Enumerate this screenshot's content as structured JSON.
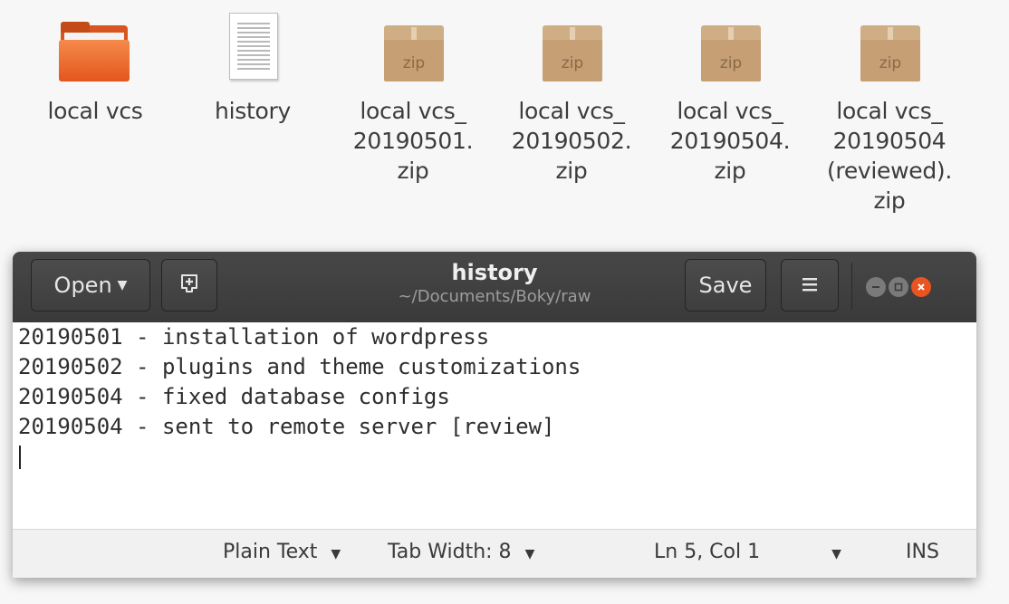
{
  "desktop": {
    "items": [
      {
        "label": "local vcs",
        "type": "folder"
      },
      {
        "label": "history",
        "type": "text-file"
      },
      {
        "label": "local vcs_\n20190501.\nzip",
        "type": "zip",
        "badge": "zip"
      },
      {
        "label": "local vcs_\n20190502.\nzip",
        "type": "zip",
        "badge": "zip"
      },
      {
        "label": "local vcs_\n20190504.\nzip",
        "type": "zip",
        "badge": "zip"
      },
      {
        "label": "local vcs_\n20190504\n(reviewed).\nzip",
        "type": "zip",
        "badge": "zip"
      }
    ]
  },
  "window": {
    "title": "history",
    "subtitle": "~/Documents/Boky/raw",
    "open_label": "Open",
    "save_label": "Save",
    "icons": {
      "open_dropdown": "chevron-down-icon",
      "new_tab": "new-document-icon",
      "menu": "hamburger-menu-icon",
      "minimize": "minimize-icon",
      "maximize": "maximize-icon",
      "close": "close-icon"
    },
    "colors": {
      "header": "#3c3c3c",
      "close_button": "#e95420"
    }
  },
  "editor": {
    "lines": [
      "20190501 - installation of wordpress",
      "20190502 - plugins and theme customizations",
      "20190504 - fixed database configs",
      "20190504 - sent to remote server [review]"
    ]
  },
  "statusbar": {
    "language": "Plain Text",
    "tab_width": "Tab Width: 8",
    "position": "Ln 5, Col 1",
    "mode": "INS"
  }
}
